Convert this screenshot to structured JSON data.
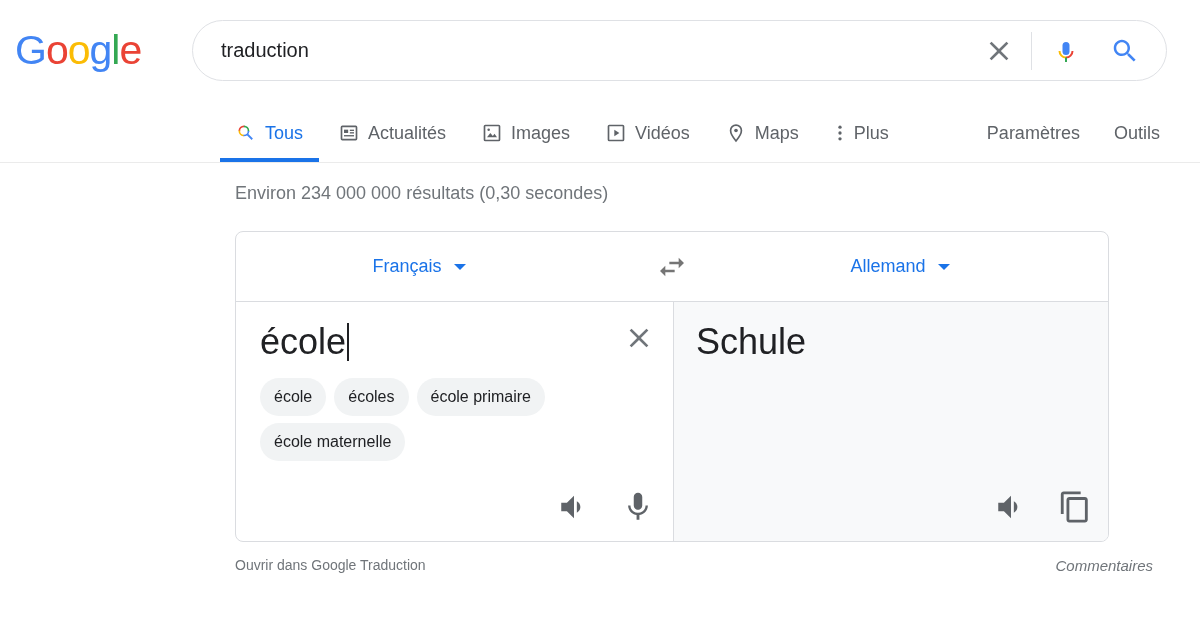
{
  "logo": "Google",
  "search": {
    "value": "traduction"
  },
  "tabs": [
    {
      "label": "Tous",
      "selected": true
    },
    {
      "label": "Actualités",
      "selected": false
    },
    {
      "label": "Images",
      "selected": false
    },
    {
      "label": "Vidéos",
      "selected": false
    },
    {
      "label": "Maps",
      "selected": false
    },
    {
      "label": "Plus",
      "selected": false
    }
  ],
  "tools": [
    "Paramètres",
    "Outils"
  ],
  "result_stats": "Environ 234 000 000 résultats (0,30 secondes)",
  "translator": {
    "source_language": "Français",
    "target_language": "Allemand",
    "input": {
      "value": "école"
    },
    "suggestions": [
      "école",
      "écoles",
      "école primaire",
      "école maternelle"
    ],
    "output": "Schule"
  },
  "footer": {
    "link": "Ouvrir dans Google Traduction",
    "feedback": "Commentaires"
  }
}
